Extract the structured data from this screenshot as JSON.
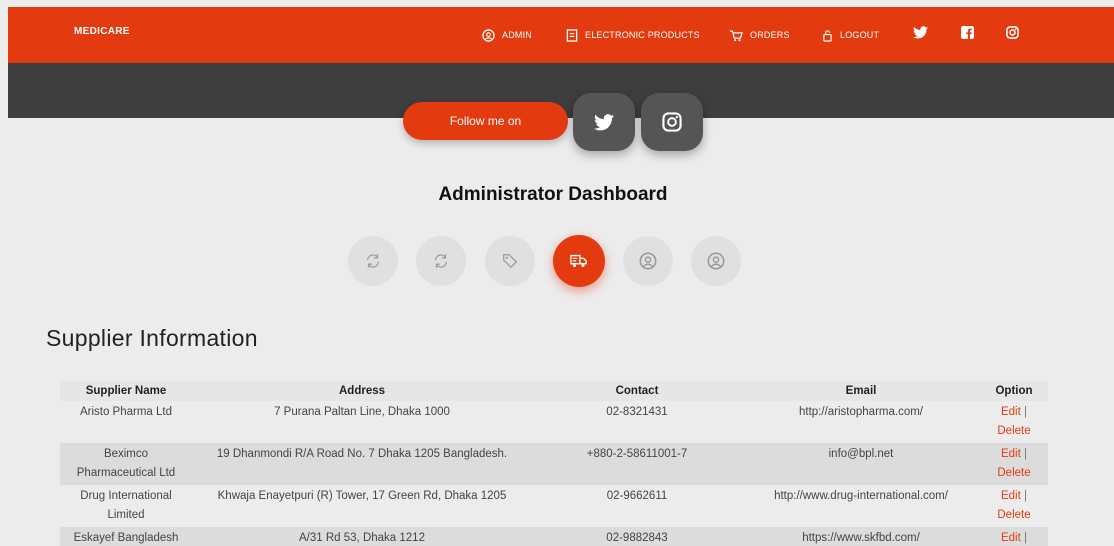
{
  "header": {
    "brand": "MEDICARE",
    "nav": [
      {
        "label": "ADMIN",
        "icon": "user-circle-icon"
      },
      {
        "label": "ELECTRONIC PRODUCTS",
        "icon": "document-icon"
      },
      {
        "label": "ORDERS",
        "icon": "cart-icon"
      },
      {
        "label": "LOGOUT",
        "icon": "logout-icon"
      }
    ],
    "social": [
      "twitter-icon",
      "facebook-icon",
      "instagram-icon"
    ]
  },
  "follow": {
    "label": "Follow me on"
  },
  "dashboard": {
    "title": "Administrator Dashboard",
    "icons": [
      "refresh-icon",
      "refresh-icon",
      "tag-icon",
      "truck-icon",
      "user-circle-icon",
      "user-circle-icon"
    ],
    "active_index": 3
  },
  "supplier": {
    "title": "Supplier Information",
    "columns": [
      "Supplier Name",
      "Address",
      "Contact",
      "Email",
      "Option"
    ],
    "rows": [
      {
        "name": "Aristo Pharma Ltd",
        "address": "7 Purana Paltan Line, Dhaka 1000",
        "contact": "02-8321431",
        "email": "http://aristopharma.com/"
      },
      {
        "name": "Beximco Pharmaceutical Ltd",
        "address": "19 Dhanmondi R/A Road No. 7 Dhaka 1205 Bangladesh.",
        "contact": "+880-2-58611001-7",
        "email": "info@bpl.net"
      },
      {
        "name": "Drug International Limited",
        "address": "Khwaja Enayetpuri (R) Tower, 17 Green Rd, Dhaka 1205",
        "contact": "02-9662611",
        "email": "http://www.drug-international.com/"
      },
      {
        "name": "Eskayef Bangladesh Limited",
        "address": "A/31 Rd 53, Dhaka 1212",
        "contact": "02-9882843",
        "email": "https://www.skfbd.com/"
      }
    ],
    "edit_label": "Edit",
    "separator": "|",
    "delete_label": "Delete"
  },
  "colors": {
    "accent": "#e33b0f",
    "dark_band": "#3e3e3e",
    "background": "#ececec"
  }
}
